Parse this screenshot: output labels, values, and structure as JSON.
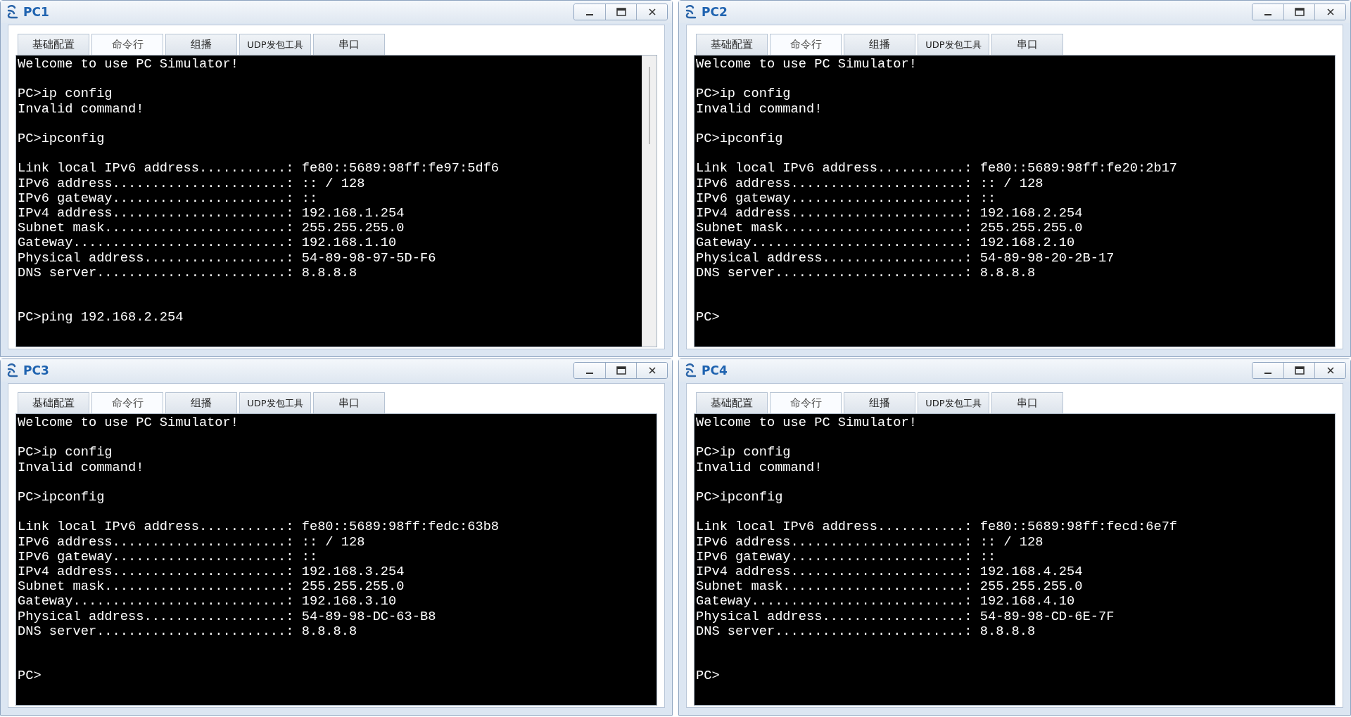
{
  "windows": [
    {
      "title": "PC1",
      "tabs": [
        {
          "label": "基础配置",
          "selected": false
        },
        {
          "label": "命令行",
          "selected": true
        },
        {
          "label": "组播",
          "selected": false
        },
        {
          "label": "UDP发包工具",
          "selected": false
        },
        {
          "label": "串口",
          "selected": false
        }
      ],
      "scrollbar": true,
      "terminal": [
        {
          "kind": "output",
          "lines": [
            "Welcome to use PC Simulator!"
          ]
        },
        {
          "kind": "output",
          "lines": [
            "PC>ip config",
            "Invalid command!"
          ]
        },
        {
          "kind": "output",
          "lines": [
            "PC>ipconfig"
          ]
        },
        {
          "kind": "output",
          "lines": [
            "Link local IPv6 address...........: fe80::5689:98ff:fe97:5df6",
            "IPv6 address......................: :: / 128",
            "IPv6 gateway......................: ::",
            "IPv4 address......................: 192.168.1.254",
            "Subnet mask.......................: 255.255.255.0",
            "Gateway...........................: 192.168.1.10",
            "Physical address..................: 54-89-98-97-5D-F6",
            "DNS server........................: 8.8.8.8"
          ]
        },
        {
          "kind": "prompt",
          "lines": [
            "PC>ping 192.168.2.254"
          ]
        }
      ]
    },
    {
      "title": "PC2",
      "tabs": [
        {
          "label": "基础配置",
          "selected": false
        },
        {
          "label": "命令行",
          "selected": true
        },
        {
          "label": "组播",
          "selected": false
        },
        {
          "label": "UDP发包工具",
          "selected": false
        },
        {
          "label": "串口",
          "selected": false
        }
      ],
      "scrollbar": false,
      "terminal": [
        {
          "kind": "output",
          "lines": [
            "Welcome to use PC Simulator!"
          ]
        },
        {
          "kind": "output",
          "lines": [
            "PC>ip config",
            "Invalid command!"
          ]
        },
        {
          "kind": "output",
          "lines": [
            "PC>ipconfig"
          ]
        },
        {
          "kind": "output",
          "lines": [
            "Link local IPv6 address...........: fe80::5689:98ff:fe20:2b17",
            "IPv6 address......................: :: / 128",
            "IPv6 gateway......................: ::",
            "IPv4 address......................: 192.168.2.254",
            "Subnet mask.......................: 255.255.255.0",
            "Gateway...........................: 192.168.2.10",
            "Physical address..................: 54-89-98-20-2B-17",
            "DNS server........................: 8.8.8.8"
          ]
        },
        {
          "kind": "prompt",
          "lines": [
            "PC>"
          ]
        }
      ]
    },
    {
      "title": "PC3",
      "tabs": [
        {
          "label": "基础配置",
          "selected": false
        },
        {
          "label": "命令行",
          "selected": true
        },
        {
          "label": "组播",
          "selected": false
        },
        {
          "label": "UDP发包工具",
          "selected": false
        },
        {
          "label": "串口",
          "selected": false
        }
      ],
      "scrollbar": false,
      "terminal": [
        {
          "kind": "output",
          "lines": [
            "Welcome to use PC Simulator!"
          ]
        },
        {
          "kind": "output",
          "lines": [
            "PC>ip config",
            "Invalid command!"
          ]
        },
        {
          "kind": "output",
          "lines": [
            "PC>ipconfig"
          ]
        },
        {
          "kind": "output",
          "lines": [
            "Link local IPv6 address...........: fe80::5689:98ff:fedc:63b8",
            "IPv6 address......................: :: / 128",
            "IPv6 gateway......................: ::",
            "IPv4 address......................: 192.168.3.254",
            "Subnet mask.......................: 255.255.255.0",
            "Gateway...........................: 192.168.3.10",
            "Physical address..................: 54-89-98-DC-63-B8",
            "DNS server........................: 8.8.8.8"
          ]
        },
        {
          "kind": "prompt",
          "lines": [
            "PC>"
          ]
        }
      ]
    },
    {
      "title": "PC4",
      "tabs": [
        {
          "label": "基础配置",
          "selected": false
        },
        {
          "label": "命令行",
          "selected": true
        },
        {
          "label": "组播",
          "selected": false
        },
        {
          "label": "UDP发包工具",
          "selected": false
        },
        {
          "label": "串口",
          "selected": false
        }
      ],
      "scrollbar": false,
      "terminal": [
        {
          "kind": "output",
          "lines": [
            "Welcome to use PC Simulator!"
          ]
        },
        {
          "kind": "output",
          "lines": [
            "PC>ip config",
            "Invalid command!"
          ]
        },
        {
          "kind": "output",
          "lines": [
            "PC>ipconfig"
          ]
        },
        {
          "kind": "output",
          "lines": [
            "Link local IPv6 address...........: fe80::5689:98ff:fecd:6e7f",
            "IPv6 address......................: :: / 128",
            "IPv6 gateway......................: ::",
            "IPv4 address......................: 192.168.4.254",
            "Subnet mask.......................: 255.255.255.0",
            "Gateway...........................: 192.168.4.10",
            "Physical address..................: 54-89-98-CD-6E-7F",
            "DNS server........................: 8.8.8.8"
          ]
        },
        {
          "kind": "prompt",
          "lines": [
            "PC>"
          ]
        }
      ]
    }
  ]
}
